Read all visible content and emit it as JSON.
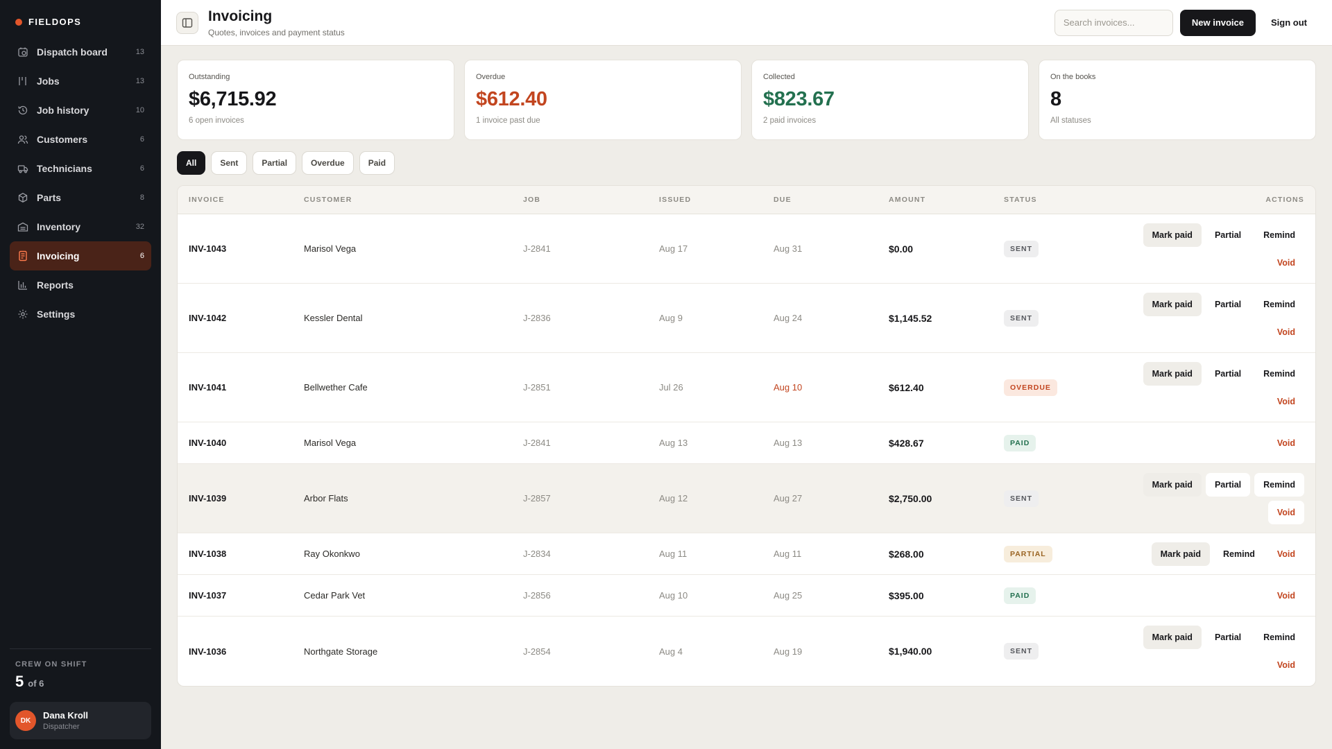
{
  "brand": {
    "name": "FIELDOPS"
  },
  "nav": [
    {
      "label": "Dispatch board",
      "count": "13",
      "icon": "dispatch-icon"
    },
    {
      "label": "Jobs",
      "count": "13",
      "icon": "jobs-icon"
    },
    {
      "label": "Job history",
      "count": "10",
      "icon": "history-icon"
    },
    {
      "label": "Customers",
      "count": "6",
      "icon": "customers-icon"
    },
    {
      "label": "Technicians",
      "count": "6",
      "icon": "truck-icon"
    },
    {
      "label": "Parts",
      "count": "8",
      "icon": "box-icon"
    },
    {
      "label": "Inventory",
      "count": "32",
      "icon": "warehouse-icon"
    },
    {
      "label": "Invoicing",
      "count": "6",
      "icon": "invoice-icon",
      "active": true
    },
    {
      "label": "Reports",
      "count": "",
      "icon": "chart-icon"
    },
    {
      "label": "Settings",
      "count": "",
      "icon": "gear-icon"
    }
  ],
  "crew": {
    "label": "CREW ON SHIFT",
    "count": "5",
    "of": "of 6"
  },
  "user": {
    "initials": "DK",
    "name": "Dana Kroll",
    "role": "Dispatcher"
  },
  "header": {
    "title": "Invoicing",
    "subtitle": "Quotes, invoices and payment status",
    "search_placeholder": "Search invoices...",
    "new_invoice_label": "New invoice",
    "sign_out_label": "Sign out"
  },
  "stats": [
    {
      "label": "Outstanding",
      "value": "$6,715.92",
      "sub": "6 open invoices",
      "color": "#17171a"
    },
    {
      "label": "Overdue",
      "value": "$612.40",
      "sub": "1 invoice past due",
      "color": "#c2451f"
    },
    {
      "label": "Collected",
      "value": "$823.67",
      "sub": "2 paid invoices",
      "color": "#23704f"
    },
    {
      "label": "On the books",
      "value": "8",
      "sub": "All statuses",
      "color": "#17171a"
    }
  ],
  "filters": [
    "All",
    "Sent",
    "Partial",
    "Overdue",
    "Paid"
  ],
  "table": {
    "headers": [
      "INVOICE",
      "CUSTOMER",
      "JOB",
      "ISSUED",
      "DUE",
      "AMOUNT",
      "STATUS",
      "ACTIONS"
    ],
    "rows": [
      {
        "invoice": "INV-1043",
        "customer": "Marisol Vega",
        "job": "J-2841",
        "issued": "Aug 17",
        "due": "Aug 31",
        "amount": "$0.00",
        "status": "SENT",
        "kind": "sent",
        "actions": [
          "Mark paid",
          "Partial",
          "Remind",
          "Void"
        ]
      },
      {
        "invoice": "INV-1042",
        "customer": "Kessler Dental",
        "job": "J-2836",
        "issued": "Aug 9",
        "due": "Aug 24",
        "amount": "$1,145.52",
        "status": "SENT",
        "kind": "sent",
        "actions": [
          "Mark paid",
          "Partial",
          "Remind",
          "Void"
        ]
      },
      {
        "invoice": "INV-1041",
        "customer": "Bellwether Cafe",
        "job": "J-2851",
        "issued": "Jul 26",
        "due": "Aug 10",
        "amount": "$612.40",
        "status": "OVERDUE",
        "kind": "overdue",
        "actions": [
          "Mark paid",
          "Partial",
          "Remind",
          "Void"
        ]
      },
      {
        "invoice": "INV-1040",
        "customer": "Marisol Vega",
        "job": "J-2841",
        "issued": "Aug 13",
        "due": "Aug 13",
        "amount": "$428.67",
        "status": "PAID",
        "kind": "paid",
        "actions": [
          "Void"
        ]
      },
      {
        "invoice": "INV-1039",
        "customer": "Arbor Flats",
        "job": "J-2857",
        "issued": "Aug 12",
        "due": "Aug 27",
        "amount": "$2,750.00",
        "status": "SENT",
        "kind": "sent",
        "hover": true,
        "actions": [
          "Mark paid",
          "Partial",
          "Remind",
          "Void"
        ]
      },
      {
        "invoice": "INV-1038",
        "customer": "Ray Okonkwo",
        "job": "J-2834",
        "issued": "Aug 11",
        "due": "Aug 11",
        "amount": "$268.00",
        "status": "PARTIAL",
        "kind": "partial",
        "actions": [
          "Mark paid",
          "Remind",
          "Void"
        ]
      },
      {
        "invoice": "INV-1037",
        "customer": "Cedar Park Vet",
        "job": "J-2856",
        "issued": "Aug 10",
        "due": "Aug 25",
        "amount": "$395.00",
        "status": "PAID",
        "kind": "paid",
        "actions": [
          "Void"
        ]
      },
      {
        "invoice": "INV-1036",
        "customer": "Northgate Storage",
        "job": "J-2854",
        "issued": "Aug 4",
        "due": "Aug 19",
        "amount": "$1,940.00",
        "status": "SENT",
        "kind": "sent",
        "actions": [
          "Mark paid",
          "Partial",
          "Remind",
          "Void"
        ]
      }
    ]
  },
  "colors": {
    "accent": "#e2562b",
    "sidebar_bg": "#14171c",
    "active_nav_bg": "#4a2318",
    "overdue": "#c2451f",
    "paid": "#23704f"
  }
}
